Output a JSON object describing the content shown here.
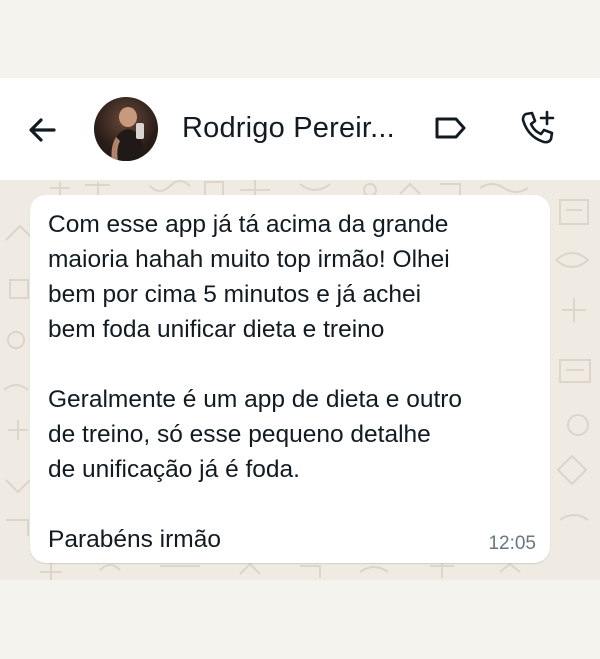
{
  "header": {
    "contact_name": "Rodrigo Pereir...",
    "back_icon": "arrow-left-icon",
    "label_icon": "tag-label-icon",
    "call_icon": "add-call-icon"
  },
  "message": {
    "text": "Com esse app já tá acima da grande\nmaioria hahah muito top irmão! Olhei\nbem por cima 5 minutos e já achei\nbem foda unificar dieta e treino\n\nGeralmente é um app de dieta e outro\nde treino, só esse pequeno detalhe\nde unificação já é foda.\n\nParabéns irmão",
    "time": "12:05"
  },
  "colors": {
    "chat_background": "#efeae2",
    "bubble": "#ffffff",
    "text": "#111b21",
    "meta": "#667781"
  }
}
